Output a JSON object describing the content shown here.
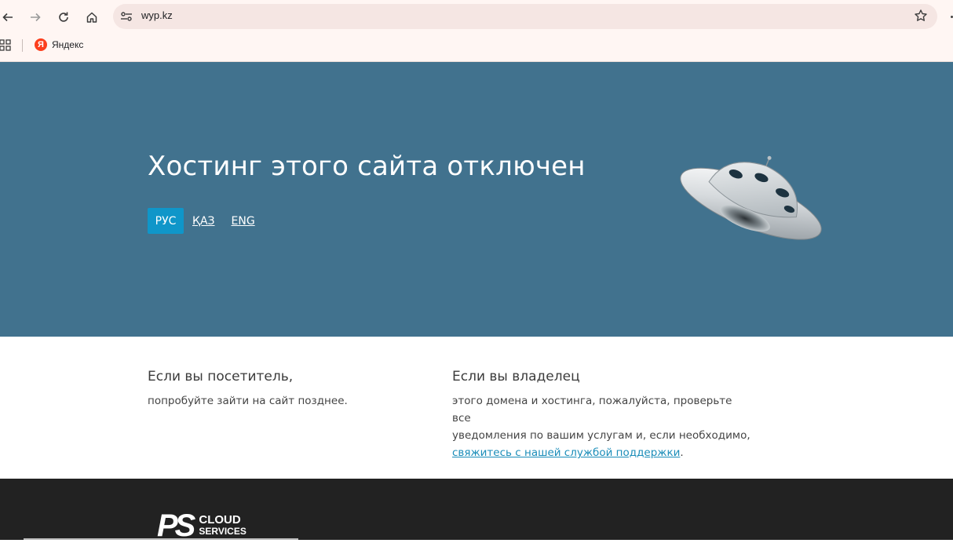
{
  "browser": {
    "url": "wyp.kz",
    "bookmarks": [
      {
        "label": "Яндекс",
        "logo_letter": "Я"
      }
    ]
  },
  "hero": {
    "title": "Хостинг этого сайта отключен",
    "languages": [
      {
        "label": "РУС",
        "active": true
      },
      {
        "label": "ҚАЗ",
        "active": false
      },
      {
        "label": "ENG",
        "active": false
      }
    ],
    "background": "#41728e",
    "accent": "#0f96c9"
  },
  "visitor": {
    "heading": "Если вы посетитель,",
    "text": "попробуйте зайти на сайт позднее."
  },
  "owner": {
    "heading": "Если вы владелец",
    "text_line1": "этого домена и хостинга, пожалуйста, проверьте все",
    "text_line2": "уведомления по вашим услугам и, если необходимо,",
    "support_link": "свяжитесь с нашей службой поддержки",
    "trailing": "."
  },
  "footer": {
    "logo_mark": "PS",
    "logo_line1": "CLOUD",
    "logo_line2": "SERVICES"
  }
}
